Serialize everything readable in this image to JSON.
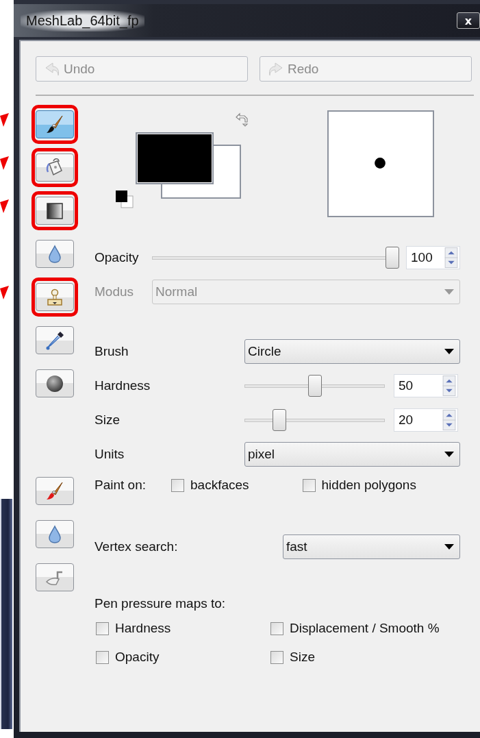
{
  "window": {
    "title": "MeshLab_64bit_fp",
    "close": "x"
  },
  "history_buttons": [
    {
      "kind": "undo",
      "label": "Undo",
      "disabled": true
    },
    {
      "kind": "redo",
      "label": "Redo",
      "disabled": true
    }
  ],
  "tools": [
    {
      "kind": "brush",
      "selected": true,
      "highlighted": true
    },
    {
      "kind": "bucket",
      "selected": false,
      "highlighted": true
    },
    {
      "kind": "gradient",
      "selected": false,
      "highlighted": true
    },
    {
      "kind": "drop",
      "selected": false,
      "highlighted": false
    },
    {
      "kind": "stamp",
      "selected": false,
      "highlighted": true
    },
    {
      "kind": "eyedropper",
      "selected": false,
      "highlighted": false
    },
    {
      "kind": "sphere",
      "selected": false,
      "highlighted": false
    },
    {
      "kind": "redbrush",
      "selected": false,
      "highlighted": false
    },
    {
      "kind": "drop",
      "selected": false,
      "highlighted": false
    },
    {
      "kind": "trowel",
      "selected": false,
      "highlighted": false
    }
  ],
  "settings": [
    {
      "kind": "slider",
      "label": "Opacity",
      "level": 1.0,
      "value": "100",
      "disabled": false
    },
    {
      "kind": "combo",
      "label": "Modus",
      "value": "Normal",
      "disabled": true
    },
    {
      "kind": "combo",
      "label": "Brush",
      "value": "Circle",
      "disabled": false
    },
    {
      "kind": "slider",
      "label": "Hardness",
      "level": 0.5,
      "value": "50",
      "disabled": false
    },
    {
      "kind": "slider",
      "label": "Size",
      "level": 0.22,
      "value": "20",
      "disabled": false
    },
    {
      "kind": "combo",
      "label": "Units",
      "value": "pixel",
      "disabled": false
    },
    {
      "kind": "checks",
      "label": "Paint on:",
      "options": [
        {
          "label": "backfaces",
          "checked": false
        },
        {
          "label": "hidden polygons",
          "checked": false
        }
      ]
    },
    {
      "kind": "combo",
      "label": "Vertex search:",
      "value": "fast",
      "disabled": false
    },
    {
      "kind": "heading",
      "label": "Pen pressure maps to:"
    },
    {
      "kind": "checkgrid",
      "options": [
        {
          "label": "Hardness",
          "checked": false
        },
        {
          "label": "Displacement / Smooth %",
          "checked": false
        },
        {
          "label": "Opacity",
          "checked": false
        },
        {
          "label": "Size",
          "checked": false
        }
      ]
    }
  ]
}
